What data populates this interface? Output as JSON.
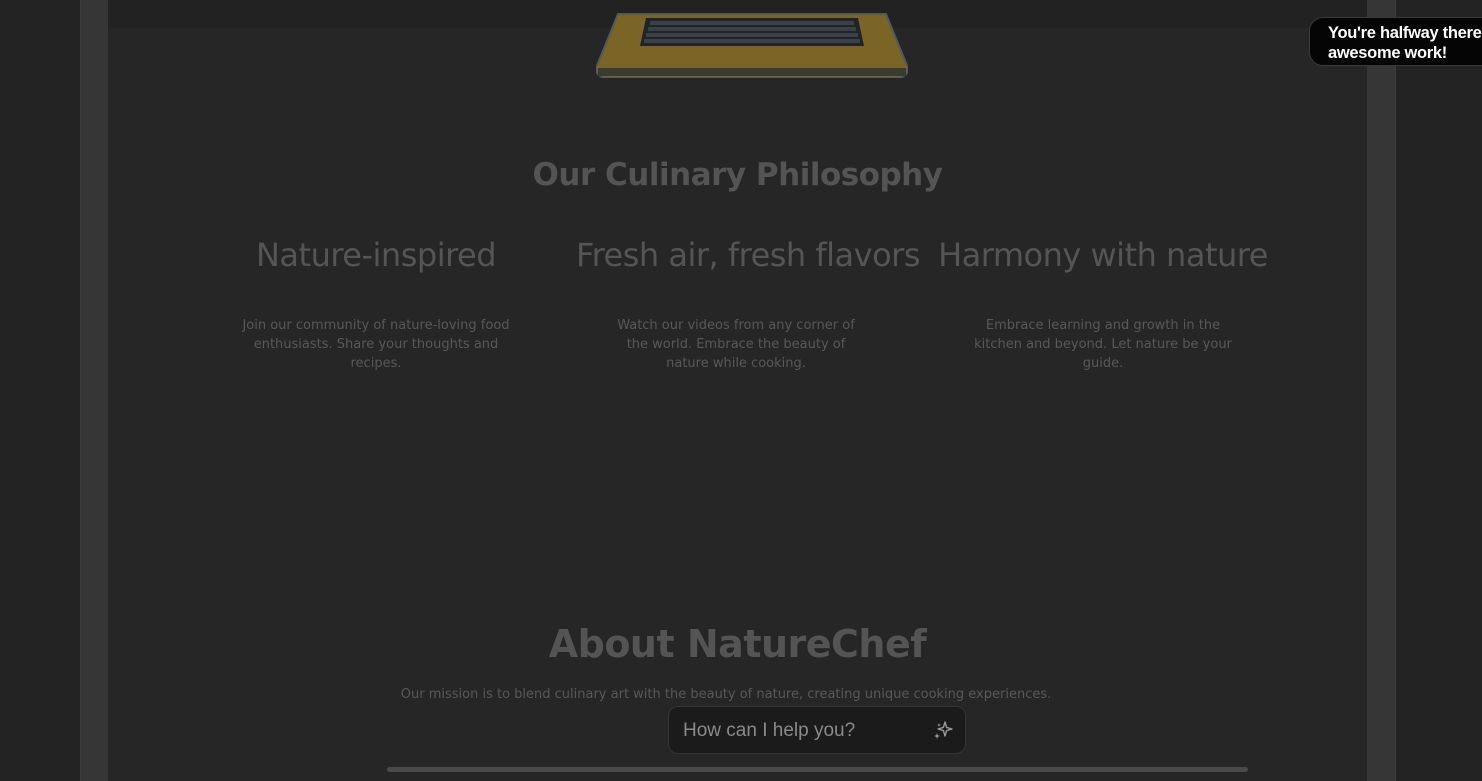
{
  "philosophy": {
    "title": "Our Culinary Philosophy",
    "features": [
      {
        "heading": "Nature-inspired",
        "text": "Join our community of nature-loving food enthusiasts. Share your thoughts and recipes."
      },
      {
        "heading": "Fresh air, fresh flavors",
        "text": "Watch our videos from any corner of the world. Embrace the beauty of nature while cooking."
      },
      {
        "heading": "Harmony with nature",
        "text": "Embrace learning and growth in the kitchen and beyond. Let nature be your guide."
      }
    ]
  },
  "about": {
    "title": "About NatureChef",
    "mission": "Our mission is to blend culinary art with the beauty of nature, creating unique cooking experiences."
  },
  "chat": {
    "placeholder": "How can I help you?",
    "icon": "sparkle-icon"
  },
  "toast": {
    "line1": "You're halfway there",
    "line2": "awesome work!"
  },
  "images": {
    "laptop": "laptop-image"
  }
}
